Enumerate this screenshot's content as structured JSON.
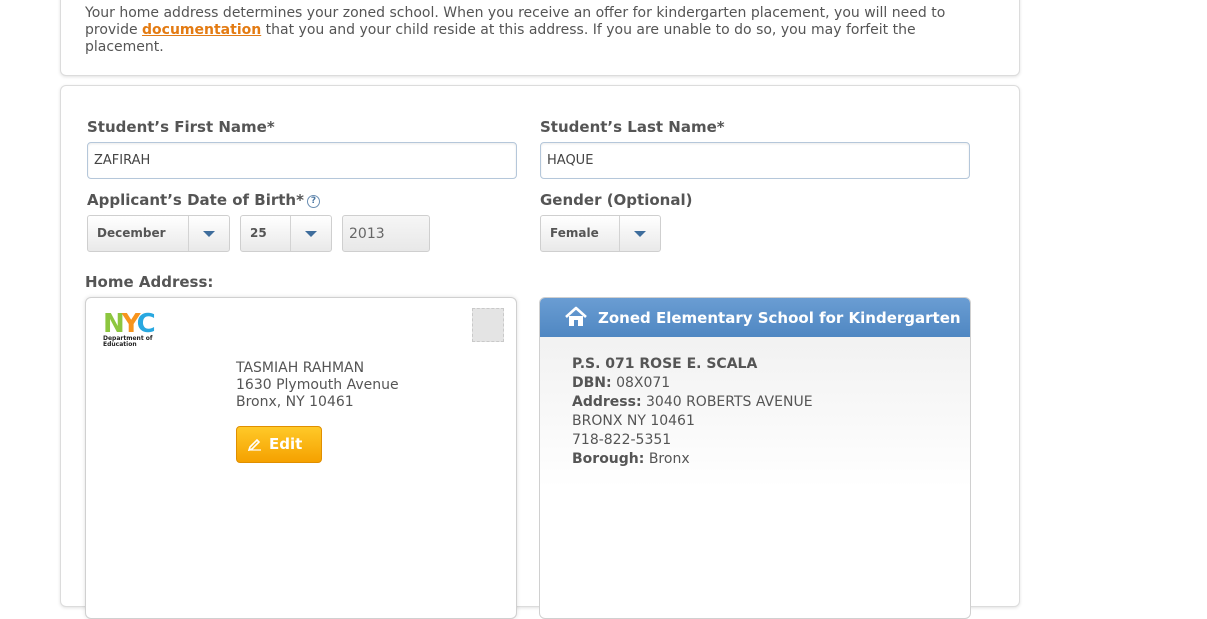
{
  "notice": {
    "text_before": "Your home address determines your zoned school. When you receive an offer for kindergarten placement, you will need to provide ",
    "link": "documentation",
    "text_after": " that you and your child reside at this address. If you are unable to do so, you may forfeit the placement."
  },
  "form": {
    "first_name": {
      "label": "Student’s First Name*",
      "value": "ZAFIRAH"
    },
    "last_name": {
      "label": "Student’s Last Name*",
      "value": "HAQUE"
    },
    "dob": {
      "label": "Applicant’s Date of Birth*",
      "help_icon": "?",
      "month": "December",
      "day": "25",
      "year": "2013"
    },
    "gender": {
      "label": "Gender (Optional)",
      "value": "Female"
    },
    "home_address_label": "Home Address:"
  },
  "address_card": {
    "logo_letters": [
      "N",
      "Y",
      "C"
    ],
    "logo_sub": [
      "Department of",
      "Education"
    ],
    "name": "TASMIAH RAHMAN",
    "street": "1630 Plymouth Avenue",
    "city": "Bronx, NY 10461",
    "edit_label": "Edit"
  },
  "zoned_school": {
    "header": "Zoned Elementary School for Kindergarten",
    "school_name": "P.S. 071 ROSE E. SCALA",
    "dbn_label": "DBN:",
    "dbn": "08X071",
    "address_label": "Address:",
    "address_line1": "3040 ROBERTS AVENUE",
    "address_line2": "BRONX NY 10461",
    "phone": "718-822-5351",
    "borough_label": "Borough:",
    "borough": "Bronx"
  },
  "colors": {
    "link": "#e37b13",
    "header_blue": "#5a8fc8",
    "edit_orange": "#f7aa00"
  }
}
